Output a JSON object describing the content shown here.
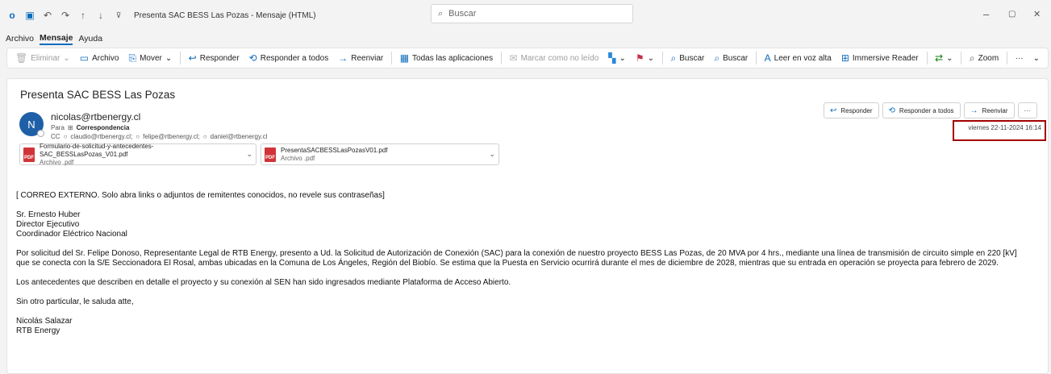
{
  "window": {
    "title": "Presenta SAC BESS Las Pozas - Mensaje (HTML)",
    "search_placeholder": "Buscar",
    "minimize": "–",
    "maximize": "▢",
    "close": "✕"
  },
  "menu": {
    "items": [
      "Archivo",
      "Mensaje",
      "Ayuda"
    ],
    "active": "Mensaje"
  },
  "ribbon": {
    "eliminar": "Eliminar",
    "archivo": "Archivo",
    "mover": "Mover",
    "responder": "Responder",
    "responder_todos": "Responder a todos",
    "reenviar": "Reenviar",
    "todas_apps": "Todas las aplicaciones",
    "marcar": "Marcar como no leído",
    "buscar1": "Buscar",
    "buscar2": "Buscar",
    "leer": "Leer en voz alta",
    "immersive": "Immersive Reader",
    "zoom": "Zoom",
    "more": "···"
  },
  "email": {
    "subject": "Presenta SAC BESS Las Pozas",
    "avatar_initial": "N",
    "sender": "nicolas@rtbenergy.cl",
    "to_label": "Para",
    "to": "Correspondencia",
    "cc_label": "CC",
    "cc": [
      "claudio@rtbenergy.cl;",
      "felipe@rtbenergy.cl;",
      "daniel@rtbenergy.cl"
    ],
    "date": "viernes 22-11-2024 16:14",
    "attachments": [
      {
        "name": "Formulario-de-solicitud-y-antecedentes-SAC_BESSLasPozas_V01.pdf",
        "type": "Archivo .pdf"
      },
      {
        "name": "PresentaSACBESSLasPozasV01.pdf",
        "type": "Archivo .pdf"
      }
    ],
    "actions": {
      "reply": "Responder",
      "reply_all": "Responder a todos",
      "forward": "Reenviar",
      "more": "···"
    },
    "body": {
      "warning": "[ CORREO EXTERNO. Solo abra links o adjuntos de remitentes conocidos, no revele sus contraseñas]",
      "addr1": "Sr. Ernesto Huber",
      "addr2": "Director Ejecutivo",
      "addr3": "Coordinador Eléctrico Nacional",
      "para1_l1": "Por solicitud del Sr. Felipe Donoso, Representante Legal de RTB Energy, presento a Ud. la Solicitud de Autorización de Conexión (SAC) para la conexión de nuestro proyecto BESS Las Pozas, de 20 MVA por 4 hrs., mediante una línea de transmisión de circuito simple en 220 [kV]",
      "para1_l2": "que se conecta con la S/E Seccionadora El Rosal, ambas ubicadas en la Comuna de Los Ángeles, Región del Biobío. Se estima que la Puesta en Servicio ocurrirá durante el mes de diciembre de 2028, mientras que su entrada en operación se proyecta para febrero de 2029.",
      "para2": "Los antecedentes que describen en detalle el proyecto y su conexión al SEN han sido ingresados mediante Plataforma de Acceso Abierto.",
      "closing": "Sin otro particular, le saluda atte,",
      "sig1": "Nicolás Salazar",
      "sig2": "RTB Energy"
    }
  },
  "colors": {
    "accent": "#0f6cbd",
    "highlight": "#a30000",
    "pdf": "#d13438"
  }
}
